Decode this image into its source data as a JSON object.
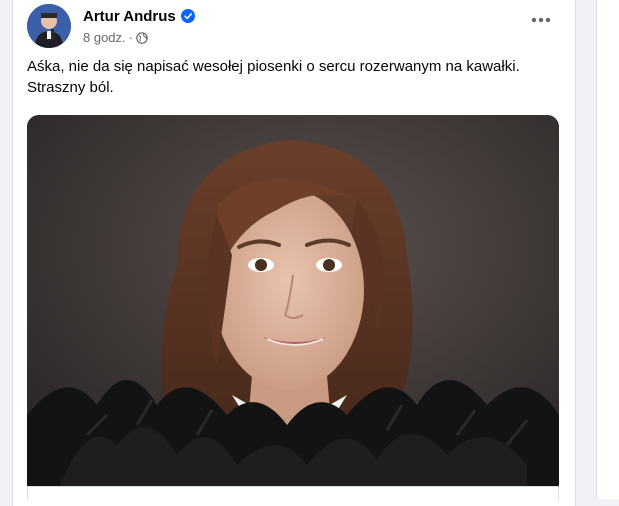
{
  "post": {
    "author": "Artur Andrus",
    "verified_icon": "verified-badge-icon",
    "time": "8 godz.",
    "separator": "·",
    "audience_icon": "globe-icon",
    "more_icon": "more-options-icon",
    "text": "Aśka, nie da się napisać wesołej piosenki o sercu rozerwanym na kawałki. Straszny ból."
  },
  "colors": {
    "accent": "#0866ff",
    "secondary_text": "#65676b",
    "primary_text": "#050505"
  }
}
